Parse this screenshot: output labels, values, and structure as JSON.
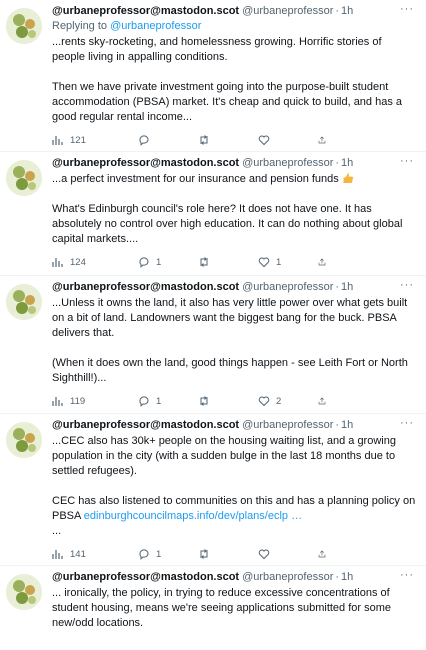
{
  "tweets": [
    {
      "name": "@urbaneprofessor@mastodon.scot",
      "handle": "@urbaneprofessor",
      "dot": "·",
      "time": "1h",
      "more": "···",
      "reply_prefix": "Replying to ",
      "reply_to": "@urbaneprofessor",
      "paragraphs": [
        "...rents sky-rocketing, and homelessness growing. Horrific stories of people living in appalling conditions.",
        "Then we have private investment going into the purpose-built student accommodation (PBSA) market. It's cheap and quick to build, and has a good regular rental income..."
      ],
      "views": "121",
      "replies": "",
      "retweets": "",
      "likes": ""
    },
    {
      "name": "@urbaneprofessor@mastodon.scot",
      "handle": "@urbaneprofessor",
      "dot": "·",
      "time": "1h",
      "more": "···",
      "paragraphs": [
        "...a perfect investment for our insurance and pension funds",
        "What's Edinburgh council's role here? It does not have one. It has absolutely no control over high education. It can do nothing about global capital markets...."
      ],
      "emoji": "thumbs-up-icon",
      "views": "124",
      "replies": "1",
      "retweets": "",
      "likes": "1"
    },
    {
      "name": "@urbaneprofessor@mastodon.scot",
      "handle": "@urbaneprofessor",
      "dot": "·",
      "time": "1h",
      "more": "···",
      "paragraphs": [
        "...Unless it owns the land, it also has very little power over what gets built on a bit of land. Landowners want the biggest bang for the buck. PBSA delivers that.",
        "(When it does own the land, good things happen - see Leith Fort or North Sighthill!)..."
      ],
      "views": "119",
      "replies": "1",
      "retweets": "",
      "likes": "2"
    },
    {
      "name": "@urbaneprofessor@mastodon.scot",
      "handle": "@urbaneprofessor",
      "dot": "·",
      "time": "1h",
      "more": "···",
      "paragraphs": [
        "...CEC also has 30k+ people on the housing waiting list, and a growing population in the city (with a sudden bulge in the last 18 months due to settled refugees).",
        "CEC has also listened to communities on this and has a planning policy on PBSA "
      ],
      "link": "edinburghcouncilmaps.info/dev/plans/eclp",
      "ellipsis": " …",
      "trailing": "...",
      "views": "141",
      "replies": "1",
      "retweets": "",
      "likes": ""
    },
    {
      "name": "@urbaneprofessor@mastodon.scot",
      "handle": "@urbaneprofessor",
      "dot": "·",
      "time": "1h",
      "more": "···",
      "paragraphs": [
        "... ironically, the policy, in trying to reduce excessive concentrations of student housing, means we're seeing applications submitted for some new/odd locations."
      ]
    }
  ],
  "icons": {
    "views": "bar-chart-icon",
    "reply": "reply-bubble-icon",
    "retweet": "retweet-icon",
    "like": "heart-icon",
    "share": "share-icon"
  },
  "colors": {
    "link": "#1d9bf0",
    "muted": "#536471",
    "text": "#0f1419"
  }
}
